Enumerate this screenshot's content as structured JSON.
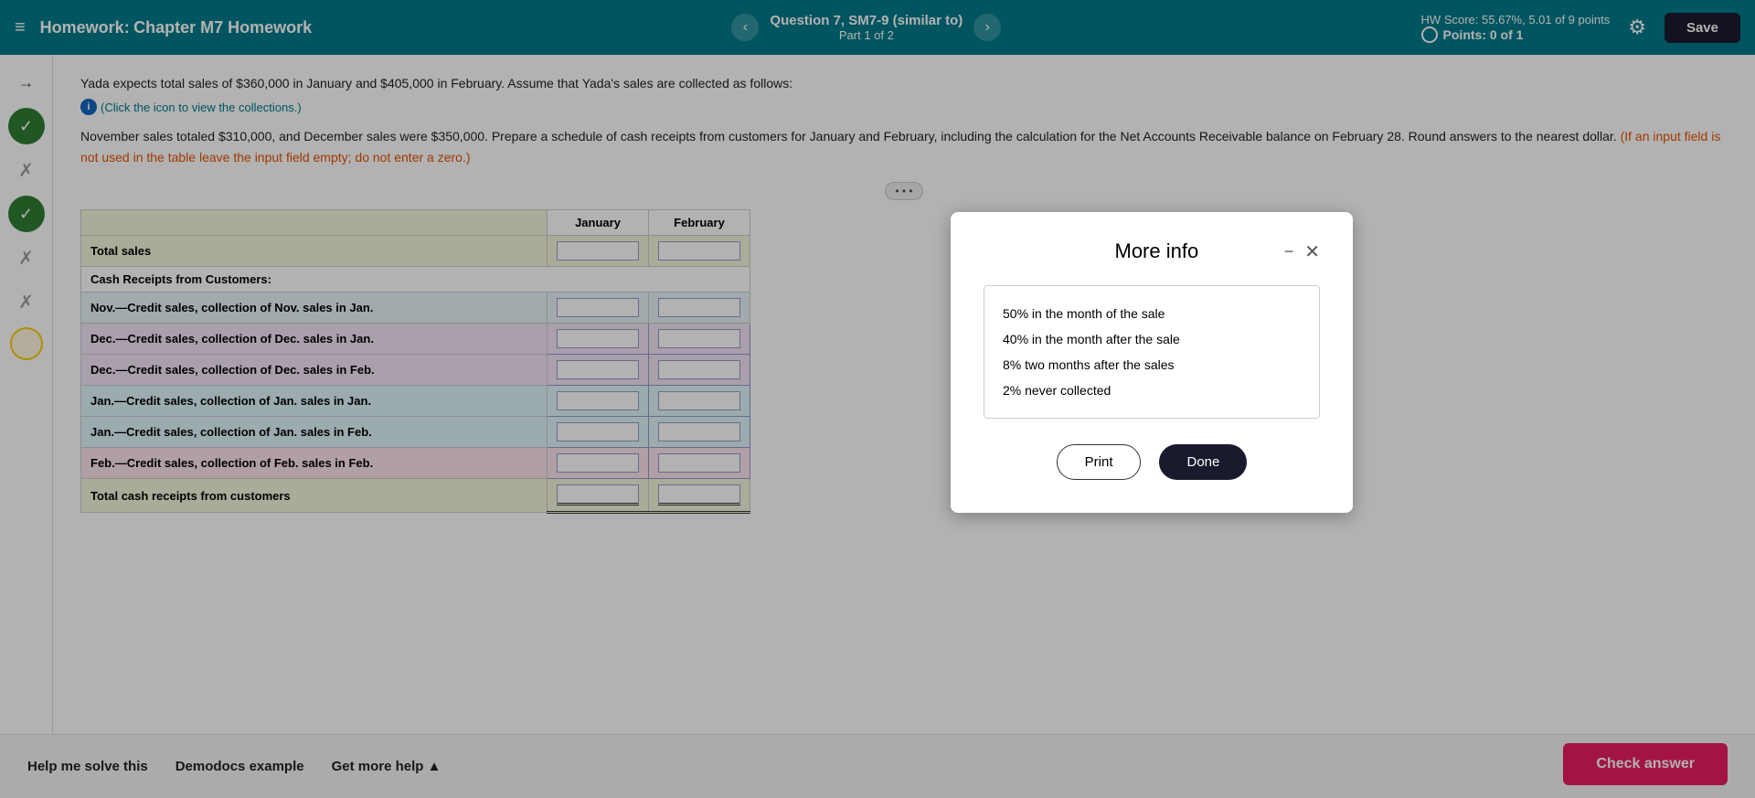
{
  "topNav": {
    "menuLabel": "≡",
    "homeworkLabel": "Homework:",
    "chapterTitle": "Chapter M7 Homework",
    "questionLabel": "Question 7, SM7-9 (similar to)",
    "partLabel": "Part 1 of 2",
    "prevBtn": "‹",
    "nextBtn": "›",
    "hwScoreLabel": "HW Score: 55.67%, 5.01 of 9 points",
    "pointsLabel": "Points: 0 of 1",
    "saveLabel": "Save"
  },
  "sidebar": {
    "items": [
      {
        "icon": "→",
        "type": "arrow"
      },
      {
        "icon": "✓",
        "type": "check-green"
      },
      {
        "icon": "✗",
        "type": "xmark-red"
      },
      {
        "icon": "✓",
        "type": "check-green"
      },
      {
        "icon": "✗",
        "type": "xmark-orange"
      },
      {
        "icon": "✗",
        "type": "xmark-orange"
      },
      {
        "icon": "",
        "type": "circle-empty"
      }
    ]
  },
  "question": {
    "text": "Yada expects total sales of $360,000 in January and $405,000 in February. Assume that Yada's sales are collected as follows:",
    "clickInfo": "(Click the icon to view the collections.)",
    "instructions": "November sales totaled $310,000, and December sales were $350,000. Prepare a schedule of cash receipts from customers for January and February, including the calculation for the Net Accounts Receivable balance on February 28. Round answers to the nearest dollar.",
    "orangeNote": "(If an input field is not used in the table leave the input field empty; do not enter a zero.)"
  },
  "table": {
    "colHeaders": [
      "January",
      "February"
    ],
    "rows": [
      {
        "label": "Total sales",
        "type": "total-sales"
      },
      {
        "label": "Cash Receipts from Customers:",
        "type": "section-header"
      },
      {
        "label": "Nov.—Credit sales, collection of Nov. sales in Jan.",
        "type": "nov"
      },
      {
        "label": "Dec.—Credit sales, collection of Dec. sales in Jan.",
        "type": "dec1"
      },
      {
        "label": "Dec.—Credit sales, collection of Dec. sales in Feb.",
        "type": "dec2"
      },
      {
        "label": "Jan.—Credit sales, collection of Jan. sales in Jan.",
        "type": "jan1"
      },
      {
        "label": "Jan.—Credit sales, collection of Jan. sales in Feb.",
        "type": "jan2"
      },
      {
        "label": "Feb.—Credit sales, collection of Feb. sales in Feb.",
        "type": "feb"
      },
      {
        "label": "Total cash receipts from customers",
        "type": "total-receipts"
      }
    ]
  },
  "modal": {
    "title": "More info",
    "items": [
      "50% in the month of the sale",
      "40% in the month after the sale",
      "8% two months after the sales",
      "2% never collected"
    ],
    "printLabel": "Print",
    "doneLabel": "Done"
  },
  "bottomBar": {
    "helpLink": "Help me solve this",
    "demodocLink": "Demodocs example",
    "getMoreHelp": "Get more help ▲",
    "checkAnswer": "Check answer"
  }
}
